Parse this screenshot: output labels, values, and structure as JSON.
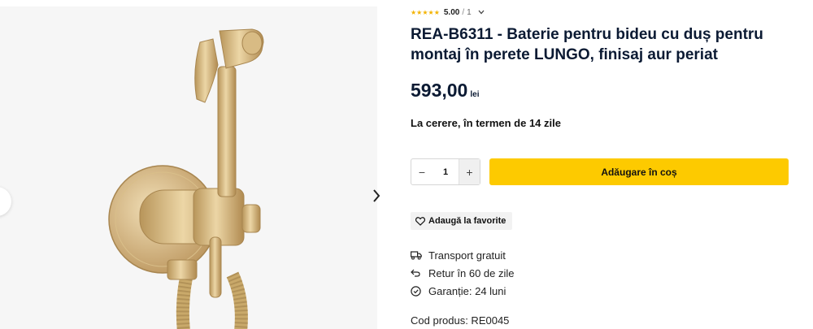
{
  "product": {
    "rating": {
      "stars": "★★★★★",
      "score": "5.00",
      "separator": "/",
      "count": "1"
    },
    "title": "REA-B6311 - Baterie pentru bideu cu duș pentru montaj în perete LUNGO, finisaj aur periat",
    "price": {
      "value": "593,00",
      "currency": "lei"
    },
    "availability": "La cerere, în termen de 14 zile",
    "quantity": {
      "value": "1",
      "minus": "−",
      "plus": "+"
    },
    "add_to_cart": "Adăugare în coș",
    "favorite": "Adaugă la favorite",
    "features": [
      {
        "icon": "truck-icon",
        "label": "Transport gratuit"
      },
      {
        "icon": "return-arrow-icon",
        "label": "Retur în 60 de zile"
      },
      {
        "icon": "badge-check-icon",
        "label": "Garanție: 24 luni"
      }
    ],
    "code": "Cod produs: RE0045"
  },
  "colors": {
    "accent": "#fdca00",
    "title": "#0b1a33",
    "star": "#f3b300",
    "gold": "#c9a96a"
  }
}
